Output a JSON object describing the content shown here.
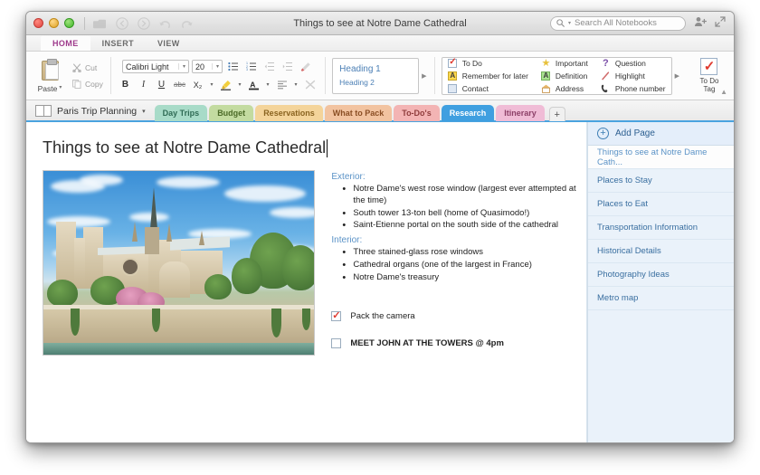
{
  "window": {
    "title": "Things to see at Notre Dame Cathedral",
    "traffic_lights": [
      "close",
      "minimize",
      "zoom"
    ],
    "toolbar_icons": [
      "folder-icon",
      "back-arrow-icon",
      "forward-arrow-icon",
      "undo-icon",
      "redo-icon"
    ],
    "search": {
      "placeholder": "Search All Notebooks",
      "icon": "search-icon"
    },
    "share_icon": "add-person-icon",
    "fullscreen_icon": "fullscreen-icon",
    "ribbon_collapse_icon": "chevron-up-icon"
  },
  "ribbon_tabs": [
    {
      "label": "HOME",
      "active": true
    },
    {
      "label": "INSERT",
      "active": false
    },
    {
      "label": "VIEW",
      "active": false
    }
  ],
  "ribbon": {
    "clipboard": {
      "paste_label": "Paste",
      "paste_icon": "clipboard-icon",
      "cut_label": "Cut",
      "cut_icon": "scissors-icon",
      "copy_label": "Copy",
      "copy_icon": "copy-icon"
    },
    "font": {
      "family": "Calibri Light",
      "size": "20",
      "bold": "B",
      "italic": "I",
      "underline": "U",
      "strikethrough": "abc",
      "subscript": "X₂",
      "highlight_icon": "highlighter-icon",
      "fontcolor_icon": "font-color-icon",
      "align_icon": "align-left-icon",
      "clear_format_icon": "clear-formatting-icon",
      "bullets_icon": "bulleted-list-icon",
      "numbering_icon": "numbered-list-icon",
      "decrease_indent_icon": "decrease-indent-icon",
      "increase_indent_icon": "increase-indent-icon",
      "styles_picker_icon": "format-painter-icon"
    },
    "styles": {
      "heading1": "Heading 1",
      "heading2": "Heading 2",
      "expand_icon": "expand-arrow-icon"
    },
    "tags": {
      "column1": [
        {
          "label": "To Do",
          "icon": "checkbox-check-icon"
        },
        {
          "label": "Remember for later",
          "icon": "yellow-a-icon"
        },
        {
          "label": "Contact",
          "icon": "contact-card-icon"
        }
      ],
      "column2": [
        {
          "label": "Important",
          "icon": "star-icon"
        },
        {
          "label": "Definition",
          "icon": "green-a-icon"
        },
        {
          "label": "Address",
          "icon": "house-icon"
        }
      ],
      "column3": [
        {
          "label": "Question",
          "icon": "question-mark-icon"
        },
        {
          "label": "Highlight",
          "icon": "highlight-pen-icon"
        },
        {
          "label": "Phone number",
          "icon": "phone-icon"
        }
      ],
      "expand_icon": "expand-arrow-icon",
      "todo_tag_label_line1": "To Do",
      "todo_tag_label_line2": "Tag",
      "todo_tag_icon": "checkbox-check-icon"
    }
  },
  "notebook": {
    "name": "Paris Trip Planning",
    "icon": "notebook-icon",
    "caret_icon": "chevron-down-icon",
    "tabs": [
      {
        "label": "Day Trips",
        "color": "#a8dbc8",
        "text": "#2f6b55",
        "active": false
      },
      {
        "label": "Budget",
        "color": "#c3dba0",
        "text": "#4c6b28",
        "active": false
      },
      {
        "label": "Reservations",
        "color": "#f4d49a",
        "text": "#8a6320",
        "active": false
      },
      {
        "label": "What to Pack",
        "color": "#f2c3a0",
        "text": "#8a4e24",
        "active": false
      },
      {
        "label": "To-Do's",
        "color": "#f3b4b4",
        "text": "#8f3c3c",
        "active": false
      },
      {
        "label": "Research",
        "color": "#3f9fe0",
        "text": "#ffffff",
        "active": true
      },
      {
        "label": "Itinerary",
        "color": "#f0bcd6",
        "text": "#8c3f67",
        "active": false
      }
    ],
    "add_tab_label": "+"
  },
  "page": {
    "title": "Things to see at Notre Dame Cathedral",
    "image_alt": "notre-dame-cathedral-photo",
    "sections": [
      {
        "heading": "Exterior:",
        "items": [
          "Notre Dame's west rose window (largest ever attempted at the time)",
          "South tower 13-ton bell (home of Quasimodo!)",
          "Saint-Etienne portal on the south side of the cathedral"
        ]
      },
      {
        "heading": "Interior:",
        "items": [
          "Three stained-glass rose windows",
          "Cathedral organs (one of the largest in France)",
          "Notre Dame's treasury"
        ]
      }
    ],
    "todos": [
      {
        "label": "Pack the camera",
        "checked": true,
        "bold": false
      },
      {
        "label": "MEET JOHN AT THE TOWERS @ 4pm",
        "checked": false,
        "bold": true
      }
    ]
  },
  "sidebar": {
    "add_page_label": "Add Page",
    "add_page_icon": "plus-circle-icon",
    "pages": [
      {
        "label": "Things to see at Notre Dame Cath...",
        "active": true
      },
      {
        "label": "Places to Stay",
        "active": false
      },
      {
        "label": "Places to Eat",
        "active": false
      },
      {
        "label": "Transportation Information",
        "active": false
      },
      {
        "label": "Historical Details",
        "active": false
      },
      {
        "label": "Photography Ideas",
        "active": false
      },
      {
        "label": "Metro map",
        "active": false
      }
    ]
  },
  "colors": {
    "accent_blue": "#4aa3df",
    "active_tab_ribbon": "#9e3a8c",
    "sidebar_bg": "#eaf2fa",
    "check_red": "#e03a2f"
  }
}
